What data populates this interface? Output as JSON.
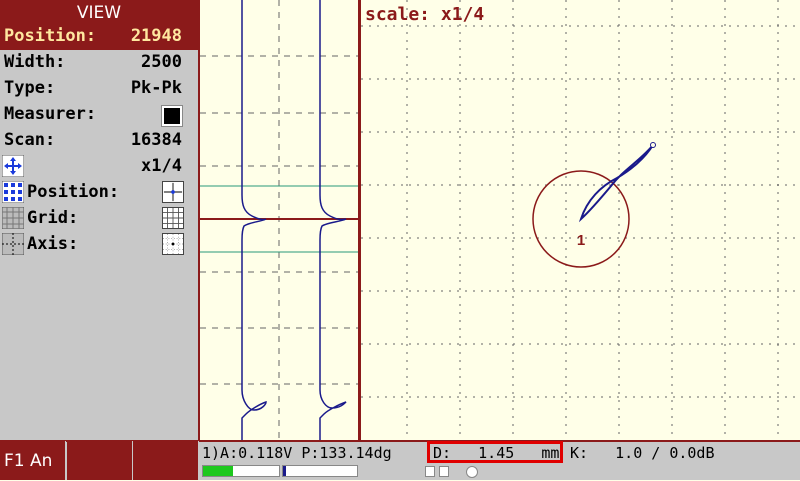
{
  "panel": {
    "title": "VIEW",
    "position_label": "Position:",
    "position_value": "21948",
    "width_label": "Width:",
    "width_value": "2500",
    "type_label": "Type:",
    "type_value": "Pk-Pk",
    "measurer_label": "Measurer:",
    "scan_label": "Scan:",
    "scan_value": "16384",
    "zoom_value": "x1/4",
    "pos_toggle_label": "Position:",
    "grid_label": "Grid:",
    "axis_label": "Axis:"
  },
  "scope": {
    "scale_label": "scale: x1/4",
    "marker_label": "1"
  },
  "bottom": {
    "f1_label": "F1 An",
    "readout_a": "1)A:0.118V P:133.14dg",
    "readout_d": "D:   1.45   mm",
    "readout_k": "K:   1.0 / 0.0dB"
  },
  "colors": {
    "accent": "#8b1a1a",
    "panel_bg": "#c8c8c8",
    "scope_bg": "#ffffe8",
    "trace_blue": "#1a1a8b",
    "highlight_red": "#e00000"
  }
}
